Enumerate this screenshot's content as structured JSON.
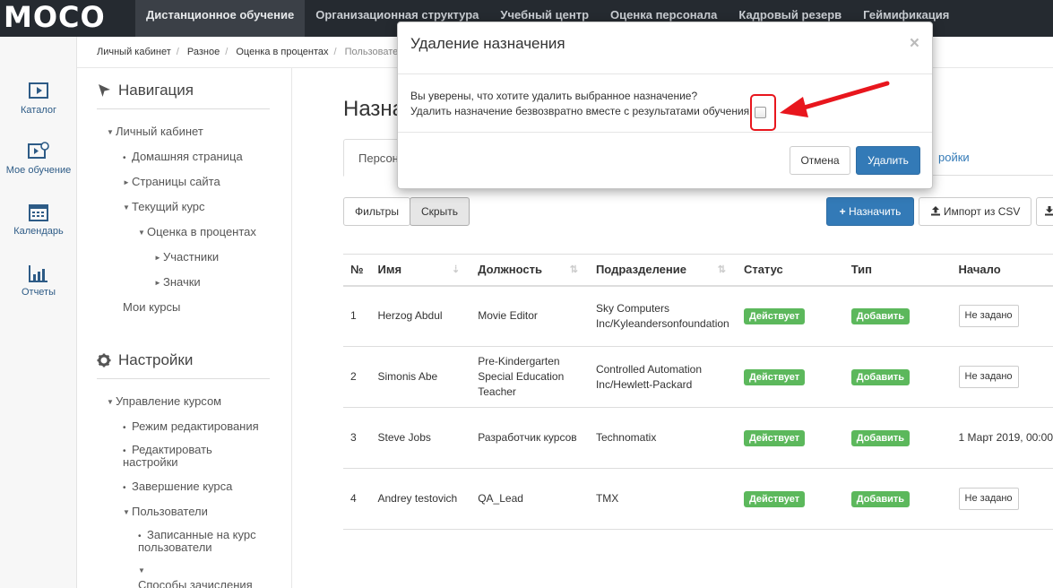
{
  "logo": "MOCO",
  "topnav": [
    "Дистанционное обучение",
    "Организационная структура",
    "Учебный центр",
    "Оценка персонала",
    "Кадровый резерв",
    "Геймификация"
  ],
  "rail": [
    "Каталог",
    "Мое обучение",
    "Календарь",
    "Отчеты"
  ],
  "breadcrumb": [
    "Личный кабинет",
    "Разное",
    "Оценка в процентах",
    "Пользовател"
  ],
  "nav": {
    "title": "Навигация",
    "items": [
      "Личный кабинет",
      "Домашняя страница",
      "Страницы сайта",
      "Текущий курс",
      "Оценка в процентах",
      "Участники",
      "Значки",
      "Мои курсы"
    ]
  },
  "settings": {
    "title": "Настройки",
    "items": [
      "Управление курсом",
      "Режим редактирования",
      "Редактировать",
      "настройки",
      "Завершение курса",
      "Пользователи",
      "Записанные на курс",
      "пользователи",
      "Способы зачисления"
    ]
  },
  "page": {
    "title": "Назна",
    "tab_active": "Персона",
    "tab_other": "ройки",
    "filters": "Фильтры",
    "hide": "Скрыть",
    "assign": "Назначить",
    "import": "Импорт из CSV"
  },
  "table": {
    "headers": [
      "№",
      "Имя",
      "Должность",
      "Подразделение",
      "Статус",
      "Тип",
      "Начало"
    ],
    "rows": [
      {
        "num": "1",
        "name": "Herzog Abdul",
        "pos": "Movie Editor",
        "dept": "Sky Computers Inc/Kyleandersonfoundation",
        "status": "Действует",
        "type": "Добавить",
        "start": "Не задано"
      },
      {
        "num": "2",
        "name": "Simonis Abe",
        "pos": "Pre-Kindergarten Special Education Teacher",
        "dept": "Controlled Automation Inc/Hewlett-Packard",
        "status": "Действует",
        "type": "Добавить",
        "start": "Не задано"
      },
      {
        "num": "3",
        "name": "Steve Jobs",
        "pos": "Разработчик курсов",
        "dept": "Technomatix",
        "status": "Действует",
        "type": "Добавить",
        "start": "1 Март 2019, 00:00"
      },
      {
        "num": "4",
        "name": "Andrey testovich",
        "pos": "QA_Lead",
        "dept": "TMX",
        "status": "Действует",
        "type": "Добавить",
        "start": "Не задано"
      }
    ]
  },
  "modal": {
    "title": "Удаление назначения",
    "close": "×",
    "line1": "Вы уверены, что хотите удалить выбранное назначение?",
    "line2": "Удалить назначение безвозвратно вместе с результатами обучения",
    "cancel": "Отмена",
    "delete": "Удалить"
  },
  "colors": {
    "accent": "#337ab7",
    "topbar": "#252a30",
    "success": "#5cb85c",
    "highlight": "#e8161d"
  }
}
